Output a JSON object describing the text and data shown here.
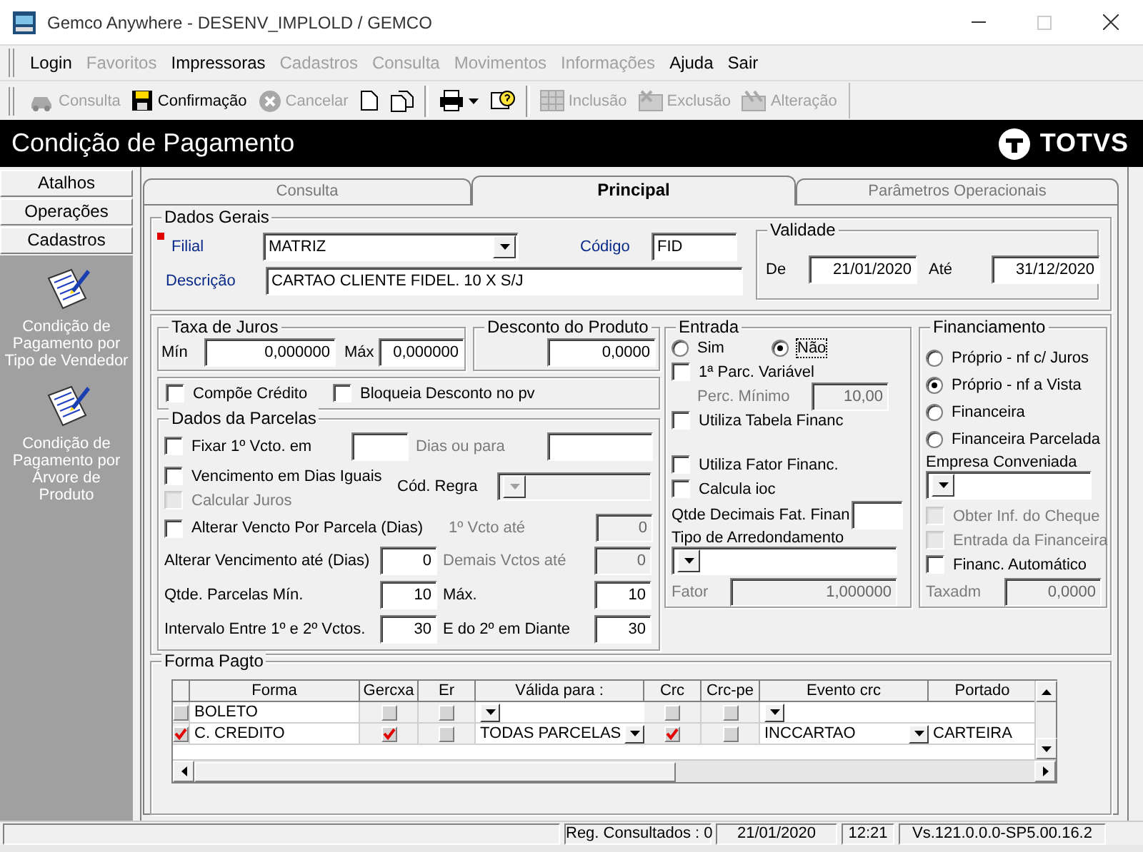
{
  "window": {
    "title": "Gemco Anywhere - DESENV_IMPLOLD / GEMCO"
  },
  "menu": [
    {
      "label": "Login",
      "disabled": false
    },
    {
      "label": "Favoritos",
      "disabled": true
    },
    {
      "label": "Impressoras",
      "disabled": false
    },
    {
      "label": "Cadastros",
      "disabled": true
    },
    {
      "label": "Consulta",
      "disabled": true
    },
    {
      "label": "Movimentos",
      "disabled": true
    },
    {
      "label": "Informações",
      "disabled": true
    },
    {
      "label": "Ajuda",
      "disabled": false
    },
    {
      "label": "Sair",
      "disabled": false
    }
  ],
  "toolbar": [
    {
      "kind": "search",
      "label": "Consulta",
      "disabled": true
    },
    {
      "kind": "save",
      "label": "Confirmação",
      "disabled": false
    },
    {
      "kind": "cancel",
      "label": "Cancelar",
      "disabled": true
    },
    {
      "kind": "new",
      "disabled": false
    },
    {
      "kind": "copy",
      "disabled": false
    },
    {
      "kind": "separator"
    },
    {
      "kind": "print",
      "disabled": false
    },
    {
      "kind": "help",
      "disabled": false
    },
    {
      "kind": "separator"
    },
    {
      "kind": "insert",
      "label": "Inclusão",
      "disabled": true
    },
    {
      "kind": "delete",
      "label": "Exclusão",
      "disabled": true
    },
    {
      "kind": "edit",
      "label": "Alteração",
      "disabled": true
    }
  ],
  "header": {
    "title": "Condição de Pagamento",
    "logo": "TOTVS"
  },
  "sidebar": {
    "sections": [
      {
        "label": "Atalhos"
      },
      {
        "label": "Operações"
      },
      {
        "label": "Cadastros"
      }
    ],
    "items": [
      {
        "label": "Condição de Pagamento por Tipo de Vendedor"
      },
      {
        "label": "Condição de Pagamento por Árvore de Produto"
      }
    ]
  },
  "tabs": [
    {
      "label": "Consulta",
      "selected": false
    },
    {
      "label": "Principal",
      "selected": true
    },
    {
      "label": "Parâmetros Operacionais",
      "selected": false
    }
  ],
  "dados_gerais": {
    "title": "Dados Gerais",
    "filial": {
      "label": "Filial",
      "value": "MATRIZ",
      "required": true
    },
    "codigo": {
      "label": "Código",
      "value": "FID"
    },
    "descricao": {
      "label": "Descrição",
      "value": "CARTAO CLIENTE FIDEL. 10 X S/J"
    },
    "validade": {
      "title": "Validade",
      "from_label": "De",
      "from": "21/01/2020",
      "to_label": "Até",
      "to": "31/12/2020"
    }
  },
  "taxa_juros": {
    "title": "Taxa de Juros",
    "min_label": "Mín",
    "min": "0,000000",
    "max_label": "Máx",
    "max": "0,000000"
  },
  "desconto_produto": {
    "title": "Desconto do Produto",
    "value": "0,0000"
  },
  "flags": [
    {
      "label": "Compõe Crédito",
      "checked": false
    },
    {
      "label": "Bloqueia Desconto no pv",
      "checked": false
    }
  ],
  "parcelas": {
    "title": "Dados da Parcelas",
    "fixar": {
      "label": "Fixar 1º Vcto. em",
      "checked": false,
      "dias_label": "Dias ou para"
    },
    "dias_iguais": {
      "label": "Vencimento em Dias Iguais",
      "checked": false
    },
    "calcular_juros": {
      "label": "Calcular Juros",
      "checked": false,
      "disabled": true
    },
    "cod_regra": {
      "label": "Cód. Regra",
      "disabled": true
    },
    "alterar_parcela": {
      "label": "Alterar Vencto Por Parcela (Dias)",
      "checked": false
    },
    "primeiro_vcto": {
      "label": "1º Vcto até",
      "value": "0",
      "disabled": true
    },
    "alterar_ate": {
      "label": "Alterar Vencimento até (Dias)",
      "value": "0"
    },
    "demais": {
      "label": "Demais Vctos até",
      "value": "0",
      "disabled": true
    },
    "min": {
      "label": "Qtde. Parcelas Mín.",
      "value": "10"
    },
    "max": {
      "label": "Máx.",
      "value": "10"
    },
    "intervalo": {
      "label": "Intervalo Entre 1º e 2º Vctos.",
      "value": "30"
    },
    "seguintes": {
      "label": "E do 2º em Diante",
      "value": "30"
    }
  },
  "entrada": {
    "title": "Entrada",
    "options": [
      {
        "label": "Sim",
        "selected": false
      },
      {
        "label": "Não",
        "selected": true
      }
    ],
    "parc_variavel": {
      "label": "1ª Parc. Variável",
      "checked": false
    },
    "perc_minimo": {
      "label": "Perc. Mínimo",
      "value": "10,00",
      "disabled": true
    },
    "tabela": {
      "label": "Utiliza Tabela Financ",
      "checked": false
    },
    "fator_financ": {
      "label": "Utiliza Fator Financ.",
      "checked": false
    },
    "ioc": {
      "label": "Calcula ioc",
      "checked": false
    },
    "decimais": {
      "label": "Qtde Decimais Fat. Finan"
    },
    "arredondamento": {
      "label": "Tipo de Arredondamento"
    },
    "fator": {
      "label": "Fator",
      "value": "1,000000",
      "disabled": true
    }
  },
  "financiamento": {
    "title": "Financiamento",
    "options": [
      {
        "label": "Próprio - nf c/ Juros",
        "selected": false
      },
      {
        "label": "Próprio - nf a Vista",
        "selected": true
      },
      {
        "label": "Financeira",
        "selected": false
      },
      {
        "label": "Financeira Parcelada",
        "selected": false
      }
    ],
    "empresa": {
      "label": "Empresa Conveniada"
    },
    "checks": [
      {
        "label": "Obter Inf. do Cheque",
        "checked": false,
        "disabled": true
      },
      {
        "label": "Entrada da Financeira",
        "checked": false,
        "disabled": true
      },
      {
        "label": "Financ. Automático",
        "checked": false,
        "disabled": false
      }
    ],
    "taxadm": {
      "label": "Taxadm",
      "value": "0,0000",
      "disabled": true
    }
  },
  "forma_pagto": {
    "title": "Forma Pagto",
    "columns": [
      "Forma",
      "Gercxa",
      "Er",
      "Válida para :",
      "Crc",
      "Crc-pe",
      "Evento crc",
      "Portado"
    ],
    "rows": [
      {
        "checked": false,
        "forma": "BOLETO",
        "gercxa": false,
        "er": false,
        "crc": false,
        "crc_pe": false
      },
      {
        "checked": true,
        "forma": "C. CREDITO",
        "gercxa": true,
        "er": false,
        "valida": "TODAS PARCELAS",
        "crc": true,
        "crc_pe": false,
        "evento": "INCCARTAO",
        "portador": "CARTEIRA"
      }
    ]
  },
  "status_bar": [
    "Reg. Consultados : 0",
    "21/01/2020",
    "12:21",
    "Vs.121.0.0.0-SP5.00.16.2"
  ]
}
